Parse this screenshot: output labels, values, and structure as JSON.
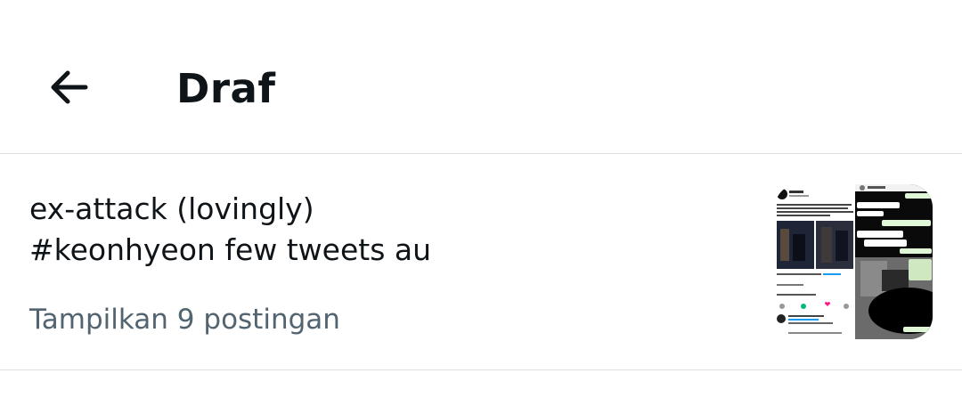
{
  "header": {
    "title": "Draf",
    "back_icon": "arrow-left-icon"
  },
  "draft": {
    "line1": "ex-attack (lovingly)",
    "line2": "#keonhyeon few tweets au",
    "show_posts": "Tampilkan 9 postingan",
    "thumbnail_icon": "tweet-screenshot-thumbnail"
  },
  "colors": {
    "text_primary": "#0f1419",
    "text_secondary": "#536471",
    "divider": "#dcdfe3",
    "like_red": "#f91880",
    "link_blue": "#1d9bf0"
  }
}
